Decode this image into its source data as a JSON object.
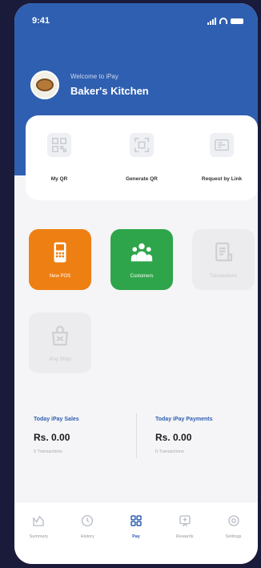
{
  "status_bar": {
    "time": "9:41"
  },
  "header": {
    "welcome": "Welcome to iPay",
    "merchant_name": "Baker's Kitchen"
  },
  "quick_actions": [
    {
      "label": "My QR"
    },
    {
      "label": "Generate QR"
    },
    {
      "label": "Request by Link"
    }
  ],
  "tiles": [
    {
      "label": "New POS",
      "state": "active",
      "color": "#ee7f12"
    },
    {
      "label": "Customers",
      "state": "active",
      "color": "#2fa54b"
    },
    {
      "label": "Transactions",
      "state": "disabled"
    },
    {
      "label": "iPay Shop",
      "state": "disabled"
    }
  ],
  "stats": [
    {
      "title": "Today iPay Sales",
      "amount": "Rs. 0.00",
      "sub": "0 Transactions"
    },
    {
      "title": "Today iPay Payments",
      "amount": "Rs. 0.00",
      "sub": "0 Transactions"
    }
  ],
  "tabbar": [
    {
      "label": "Summary"
    },
    {
      "label": "History"
    },
    {
      "label": "Pay",
      "active": true
    },
    {
      "label": "Rewards"
    },
    {
      "label": "Settings"
    }
  ],
  "colors": {
    "brand_blue": "#2f5fb0",
    "orange": "#ee7f12",
    "green": "#2fa54b",
    "background": "#1a1a3a"
  }
}
